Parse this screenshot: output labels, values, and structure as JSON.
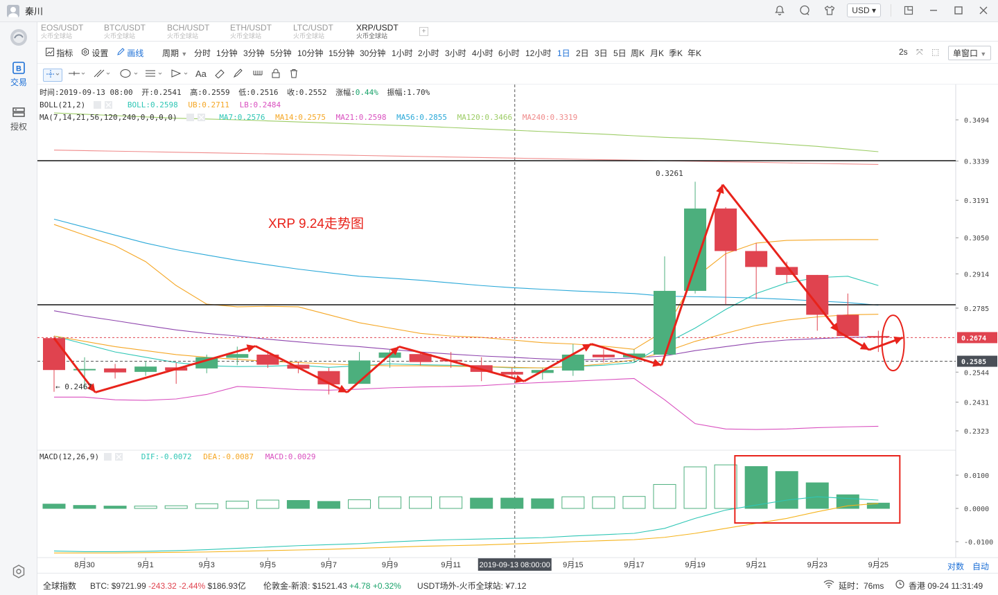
{
  "user": {
    "name": "秦川"
  },
  "titlebar": {
    "currency": "USD"
  },
  "sidebar": {
    "items": [
      {
        "label": "交易"
      },
      {
        "label": "授权"
      }
    ]
  },
  "tabs": [
    {
      "pair": "EOS/USDT",
      "source": "火币全球站"
    },
    {
      "pair": "BTC/USDT",
      "source": "火币全球站"
    },
    {
      "pair": "BCH/USDT",
      "source": "火币全球站"
    },
    {
      "pair": "ETH/USDT",
      "source": "火币全球站"
    },
    {
      "pair": "LTC/USDT",
      "source": "火币全球站"
    },
    {
      "pair": "XRP/USDT",
      "source": "火币全球站",
      "active": true
    }
  ],
  "periodbar": {
    "indicator": "指标",
    "settings": "设置",
    "draw": "画线",
    "period": "周期",
    "periods": [
      "分时",
      "1分钟",
      "3分钟",
      "5分钟",
      "10分钟",
      "15分钟",
      "30分钟",
      "1小时",
      "2小时",
      "3小时",
      "4小时",
      "6小时",
      "12小时",
      "1日",
      "2日",
      "3日",
      "5日",
      "周K",
      "月K",
      "季K",
      "年K"
    ],
    "active_period": "1日",
    "refresh": "2s",
    "window_mode": "单窗口"
  },
  "toolsbar": {
    "text_tool": "Aa"
  },
  "chart_data": {
    "type": "candlestick",
    "title": "XRP 9.24走势图",
    "info_line": {
      "time_label": "时间:2019-09-13 08:00",
      "open": "开:0.2541",
      "high": "高:0.2559",
      "low": "低:0.2516",
      "close": "收:0.2552",
      "change_label": "涨幅:",
      "change": "0.44%",
      "amplitude": "振幅:1.70%"
    },
    "boll_legend": {
      "name": "BOLL(21,2)",
      "boll": "BOLL:0.2598",
      "ub": "UB:0.2711",
      "lb": "LB:0.2484"
    },
    "ma_legend": {
      "name": "MA(7,14,21,56,120,240,0,0,0,0)",
      "ma7": "MA7:0.2576",
      "ma14": "MA14:0.2575",
      "ma21": "MA21:0.2598",
      "ma56": "MA56:0.2855",
      "ma120": "MA120:0.3466",
      "ma240": "MA240:0.3319"
    },
    "macd_legend": {
      "name": "MACD(12,26,9)",
      "dif": "DIF:-0.0072",
      "dea": "DEA:-0.0087",
      "macd": "MACD:0.0029"
    },
    "price_ticks": [
      0.3494,
      0.3339,
      0.3191,
      0.305,
      0.2914,
      0.2785,
      0.2544,
      0.2431,
      0.2323
    ],
    "price_tick_labels": [
      "0.3494",
      "0.3339",
      "0.3191",
      "0.3050",
      "0.2914",
      "0.2785",
      "0.2544",
      "0.2431",
      "0.2323"
    ],
    "current_price": "0.2674",
    "crosshair_price": "0.2585",
    "macd_ticks": [
      "0.0100",
      "0.0000",
      "-0.0100"
    ],
    "macd_tick_values": [
      0.01,
      0,
      -0.01
    ],
    "x_labels": [
      "8月30",
      "9月1",
      "9月3",
      "9月5",
      "9月7",
      "9月9",
      "9月11",
      "9月15",
      "9月17",
      "9月19",
      "9月21",
      "9月23",
      "9月25"
    ],
    "x_label_index": [
      1,
      3,
      5,
      7,
      9,
      11,
      13,
      17,
      19,
      21,
      23,
      25,
      27
    ],
    "crosshair_time": "2019-09-13 08:00:00",
    "crosshair_index": 15,
    "annotations": {
      "high_label": "0.3261",
      "low_label": "0.2467"
    },
    "colors": {
      "up": "#4caf7d",
      "down": "#e0434f",
      "ub": "#f5a623",
      "lb": "#d94fbf",
      "mid": "#8e44ad",
      "ma56": "#29a8d8",
      "ma120": "#9ccc65",
      "ma240": "#ef8a8a",
      "arrow": "#e8231b",
      "dif": "#2ec6b5",
      "dea": "#f5b31b"
    },
    "candles": [
      {
        "o": 0.2672,
        "h": 0.268,
        "l": 0.247,
        "c": 0.2552
      },
      {
        "o": 0.2552,
        "h": 0.26,
        "l": 0.248,
        "c": 0.2556
      },
      {
        "o": 0.2558,
        "h": 0.2575,
        "l": 0.252,
        "c": 0.2543
      },
      {
        "o": 0.2545,
        "h": 0.2585,
        "l": 0.253,
        "c": 0.2565
      },
      {
        "o": 0.2562,
        "h": 0.258,
        "l": 0.25,
        "c": 0.255
      },
      {
        "o": 0.2558,
        "h": 0.261,
        "l": 0.254,
        "c": 0.26
      },
      {
        "o": 0.2598,
        "h": 0.264,
        "l": 0.257,
        "c": 0.2612
      },
      {
        "o": 0.261,
        "h": 0.2625,
        "l": 0.256,
        "c": 0.2572
      },
      {
        "o": 0.2572,
        "h": 0.2585,
        "l": 0.254,
        "c": 0.2557
      },
      {
        "o": 0.2548,
        "h": 0.256,
        "l": 0.246,
        "c": 0.2498
      },
      {
        "o": 0.25,
        "h": 0.262,
        "l": 0.25,
        "c": 0.2588
      },
      {
        "o": 0.2598,
        "h": 0.263,
        "l": 0.256,
        "c": 0.2618
      },
      {
        "o": 0.2612,
        "h": 0.262,
        "l": 0.257,
        "c": 0.2582
      },
      {
        "o": 0.259,
        "h": 0.262,
        "l": 0.256,
        "c": 0.2589
      },
      {
        "o": 0.257,
        "h": 0.26,
        "l": 0.251,
        "c": 0.2545
      },
      {
        "o": 0.2545,
        "h": 0.256,
        "l": 0.252,
        "c": 0.2535
      },
      {
        "o": 0.2541,
        "h": 0.2559,
        "l": 0.2516,
        "c": 0.2552
      },
      {
        "o": 0.255,
        "h": 0.265,
        "l": 0.253,
        "c": 0.261
      },
      {
        "o": 0.261,
        "h": 0.263,
        "l": 0.258,
        "c": 0.26
      },
      {
        "o": 0.26,
        "h": 0.263,
        "l": 0.258,
        "c": 0.2614
      },
      {
        "o": 0.261,
        "h": 0.298,
        "l": 0.26,
        "c": 0.285
      },
      {
        "o": 0.285,
        "h": 0.3261,
        "l": 0.284,
        "c": 0.316
      },
      {
        "o": 0.316,
        "h": 0.3165,
        "l": 0.28,
        "c": 0.3
      },
      {
        "o": 0.3,
        "h": 0.303,
        "l": 0.282,
        "c": 0.294
      },
      {
        "o": 0.294,
        "h": 0.296,
        "l": 0.288,
        "c": 0.291
      },
      {
        "o": 0.291,
        "h": 0.291,
        "l": 0.27,
        "c": 0.276
      },
      {
        "o": 0.276,
        "h": 0.284,
        "l": 0.268,
        "c": 0.268
      },
      {
        "o": 0.268,
        "h": 0.27,
        "l": 0.262,
        "c": 0.2674
      }
    ],
    "macd_hist": [
      0.0013,
      0.0009,
      0.0007,
      0.0007,
      0.0008,
      0.0014,
      0.0022,
      0.0025,
      0.0024,
      0.0021,
      0.0026,
      0.0035,
      0.0035,
      0.0035,
      0.0031,
      0.0031,
      0.0029,
      0.0035,
      0.0035,
      0.0036,
      0.0072,
      0.0125,
      0.0131,
      0.0126,
      0.0111,
      0.0077,
      0.0041,
      0.0016
    ],
    "macd_filled": [
      true,
      true,
      true,
      false,
      false,
      false,
      false,
      false,
      true,
      true,
      false,
      false,
      false,
      false,
      true,
      true,
      true,
      false,
      false,
      false,
      false,
      false,
      false,
      true,
      true,
      true,
      true,
      true
    ]
  },
  "statusbar": {
    "index_label": "全球指数",
    "btc_label": "BTC:",
    "btc_price": "$9721.99",
    "btc_change": "-243.32",
    "btc_pct": "-2.44%",
    "btc_vol": "$186.93亿",
    "gold_label": "伦敦金-新浪:",
    "gold_price": "$1521.43",
    "gold_change": "+4.78",
    "gold_pct": "+0.32%",
    "otc_label": "USDT场外-火币全球站:",
    "otc_price": "¥7.12",
    "latency": "延时：76ms",
    "clock": "香港 09-24 11:31:49",
    "chart_controls": [
      "对数",
      "自动"
    ]
  }
}
